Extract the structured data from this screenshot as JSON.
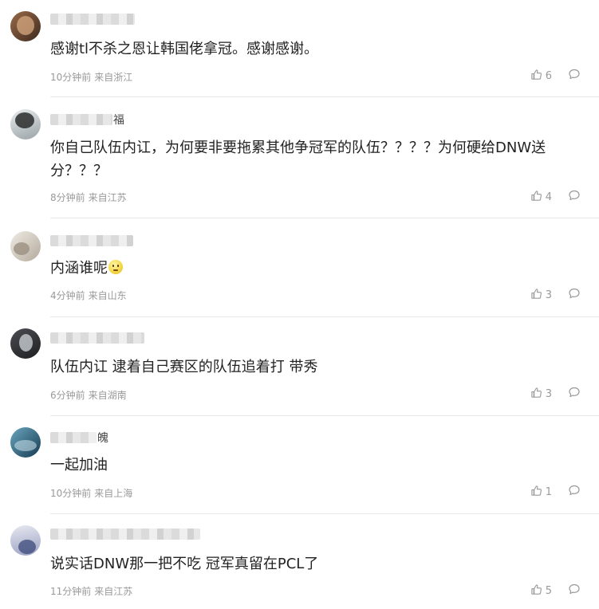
{
  "comments": [
    {
      "username_suffix": "",
      "content": "感谢tl不杀之恩让韩国佬拿冠。感谢感谢。",
      "time": "10分钟前",
      "location": "来自浙江",
      "likes": "6",
      "avatar_colors": [
        "#6b4a33",
        "#c9a07a"
      ]
    },
    {
      "username_suffix": "福",
      "content": "你自己队伍内讧，为何要非要拖累其他争冠军的队伍？？？？为何硬给DNW送分？？？",
      "time": "8分钟前",
      "location": "来自江苏",
      "likes": "4",
      "avatar_colors": [
        "#3a3a3a",
        "#bfc6c9"
      ]
    },
    {
      "username_suffix": "",
      "content": "内涵谁呢",
      "time": "4分钟前",
      "location": "来自山东",
      "likes": "3",
      "avatar_colors": [
        "#d8d2c8",
        "#a59a8b"
      ]
    },
    {
      "username_suffix": "",
      "content": "队伍内讧 逮着自己赛区的队伍追着打 带秀",
      "time": "6分钟前",
      "location": "来自湖南",
      "likes": "3",
      "avatar_colors": [
        "#2d2f33",
        "#9fa4ab"
      ]
    },
    {
      "username_suffix": "魄",
      "content": "一起加油",
      "time": "10分钟前",
      "location": "来自上海",
      "likes": "1",
      "avatar_colors": [
        "#1f4f66",
        "#7fb3c8"
      ]
    },
    {
      "username_suffix": "",
      "content": "说实话DNW那一把不吃 冠军真留在PCL了",
      "time": "11分钟前",
      "location": "来自江苏",
      "likes": "5",
      "avatar_colors": [
        "#c7c9d6",
        "#4c5a8c"
      ]
    }
  ]
}
